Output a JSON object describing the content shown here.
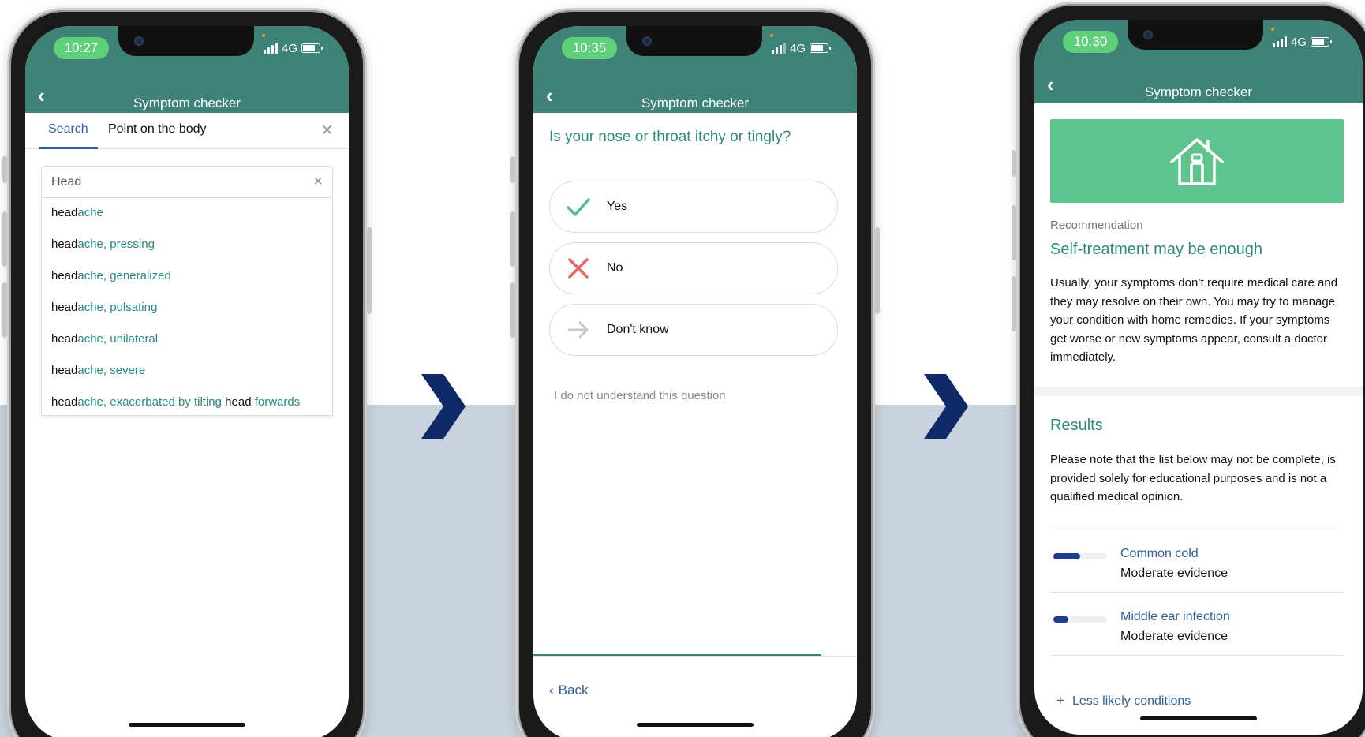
{
  "colors": {
    "header": "#3f8278",
    "accent_teal": "#2a8a7d",
    "link_blue": "#2f5f9a",
    "time_pill": "#5fd07a",
    "banner_green": "#5ec48d",
    "arrow_navy": "#0f2a66",
    "background_band": "#c9d3dd"
  },
  "phone1": {
    "time": "10:27",
    "network": "4G",
    "title": "Symptom checker",
    "tabs": [
      {
        "label": "Search",
        "active": true
      },
      {
        "label": "Point on the body",
        "active": false
      }
    ],
    "search": {
      "value": "Head"
    },
    "suggestions": [
      {
        "parts": [
          {
            "text": "head",
            "match": true
          },
          {
            "text": "ache",
            "match": false
          }
        ]
      },
      {
        "parts": [
          {
            "text": "head",
            "match": true
          },
          {
            "text": "ache, pressing",
            "match": false
          }
        ]
      },
      {
        "parts": [
          {
            "text": "head",
            "match": true
          },
          {
            "text": "ache, generalized",
            "match": false
          }
        ]
      },
      {
        "parts": [
          {
            "text": "head",
            "match": true
          },
          {
            "text": "ache, pulsating",
            "match": false
          }
        ]
      },
      {
        "parts": [
          {
            "text": "head",
            "match": true
          },
          {
            "text": "ache, unilateral",
            "match": false
          }
        ]
      },
      {
        "parts": [
          {
            "text": "head",
            "match": true
          },
          {
            "text": "ache, severe",
            "match": false
          }
        ]
      },
      {
        "parts": [
          {
            "text": "head",
            "match": true
          },
          {
            "text": "ache, exacerbated by tilting ",
            "match": false
          },
          {
            "text": "head",
            "match": true
          },
          {
            "text": " forwards",
            "match": false
          }
        ]
      }
    ]
  },
  "phone2": {
    "time": "10:35",
    "network": "4G",
    "title": "Symptom checker",
    "question": "Is your nose or throat itchy or tingly?",
    "answers": [
      {
        "label": "Yes",
        "icon": "check-icon"
      },
      {
        "label": "No",
        "icon": "cross-icon"
      },
      {
        "label": "Don't know",
        "icon": "arrow-right-icon"
      }
    ],
    "help_link": "I do not understand this question",
    "progress": 0.89,
    "back_label": "Back"
  },
  "phone3": {
    "time": "10:30",
    "network": "4G",
    "title": "Symptom checker",
    "banner_icon": "house-icon",
    "recommendation_label": "Recommendation",
    "recommendation_title": "Self-treatment may be enough",
    "recommendation_body": "Usually, your symptoms don’t require medical care and they may resolve on their own. You may try to manage your condition with home remedies. If your symptoms get worse or new symptoms appear, consult a doctor immediately.",
    "results_title": "Results",
    "results_body": "Please note that the list below may not be complete, is provided solely for educational purposes and is not a qualified medical opinion.",
    "conditions": [
      {
        "name": "Common cold",
        "evidence": "Moderate evidence",
        "strength": 0.5
      },
      {
        "name": "Middle ear infection",
        "evidence": "Moderate evidence",
        "strength": 0.28
      }
    ],
    "less_likely": "Less likely conditions"
  }
}
